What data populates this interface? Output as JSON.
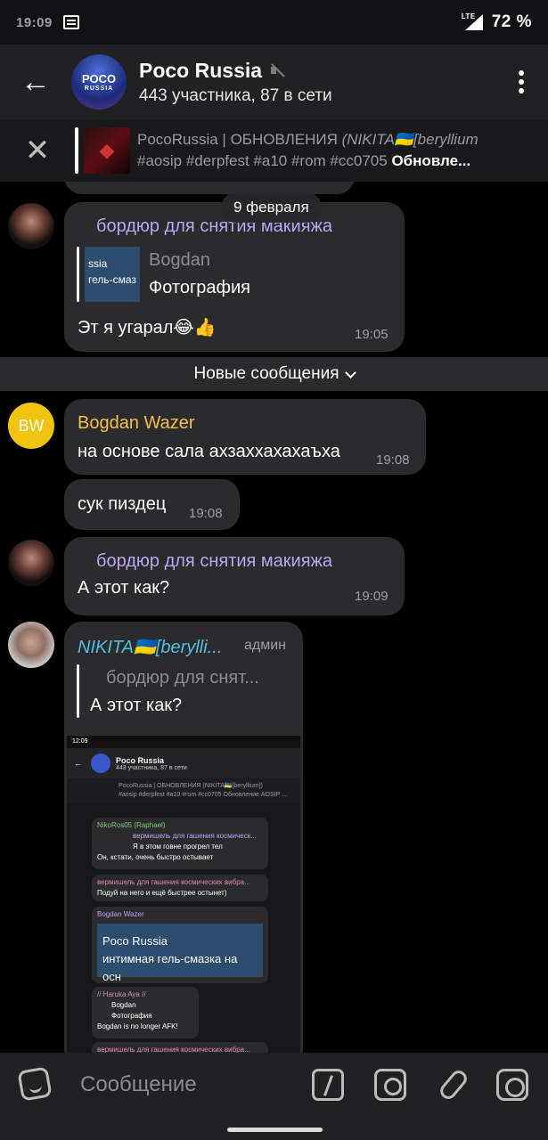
{
  "status": {
    "time": "19:09",
    "network": "LTE",
    "battery": "72 %"
  },
  "chat": {
    "title": "Poco Russia",
    "subtitle": "443 участника, 87 в сети",
    "avatar_top": "POCO",
    "avatar_bottom": "RUSSIA"
  },
  "pinned": {
    "line1_title": "PocoRussia | ОБНОВЛЕНИЯ",
    "line1_author": "(NIKITA🇺🇦[beryllium",
    "line2_tags": "#aosip #derpfest #a10 #rom #cc0705",
    "line2_bold": "Обновле..."
  },
  "date_separator": "9 февраля",
  "new_messages_label": "Новые сообщения",
  "messages": [
    {
      "sender": "бордюр для снятия макияжа",
      "reply_thumb_line1": "ssia",
      "reply_thumb_line2": "гель-смаз",
      "reply_author": "Bogdan",
      "reply_text": "Фотография",
      "text": "Эт я угарал😂👍",
      "time": "19:05"
    },
    {
      "sender": "Bogdan Wazer",
      "avatar_initials": "BW",
      "text": "на основе сала ахзаххахахаъха",
      "time": "19:08"
    },
    {
      "text": "сук пиздец",
      "time": "19:08"
    },
    {
      "sender": "бордюр для снятия макияжа",
      "text": "А этот как?",
      "time": "19:09"
    },
    {
      "sender": "NIKITA🇺🇦[berylli...",
      "badge": "админ",
      "reply_author": "бордюр для снят...",
      "reply_text": "А этот как?"
    }
  ],
  "screenshot_preview": {
    "status_time": "12:09",
    "title": "Poco Russia",
    "subtitle": "443 участника, 87 в сети",
    "pin1": "PocoRussia | ОБНОВЛЕНИЯ (NIKITA🇺🇦[beryllium])",
    "pin2": "#aosip #derpfest #a10 #rom #cc0705 Обновление AOSIP ...",
    "rows": [
      {
        "name": "NikoRos05 (Raphael)",
        "reply": "вермишель для гашения космическ...",
        "reply_sub": "Я в этом говне прогрел тел",
        "text": "Он, кстати, очень быстро остывает",
        "time": "11:51"
      },
      {
        "name": "вермишель для гашения космических вибра...",
        "text": "Подуй на него и ещё быстрее остынет)",
        "time": "11:51"
      },
      {
        "name": "Bogdan Wazer",
        "image_title": "Poco Russia",
        "image_caption": "интимная гель-смазка на осн",
        "time": "12:04"
      },
      {
        "name": "// Haruka Aya //",
        "badge": "Бот",
        "reply": "Bogdan",
        "reply_sub": "Фотография",
        "text": "Bogdan is no longer AFK!",
        "time": "12:04"
      },
      {
        "name": "вермишель для гашения космических вибра..."
      }
    ]
  },
  "input": {
    "placeholder": "Сообщение"
  }
}
